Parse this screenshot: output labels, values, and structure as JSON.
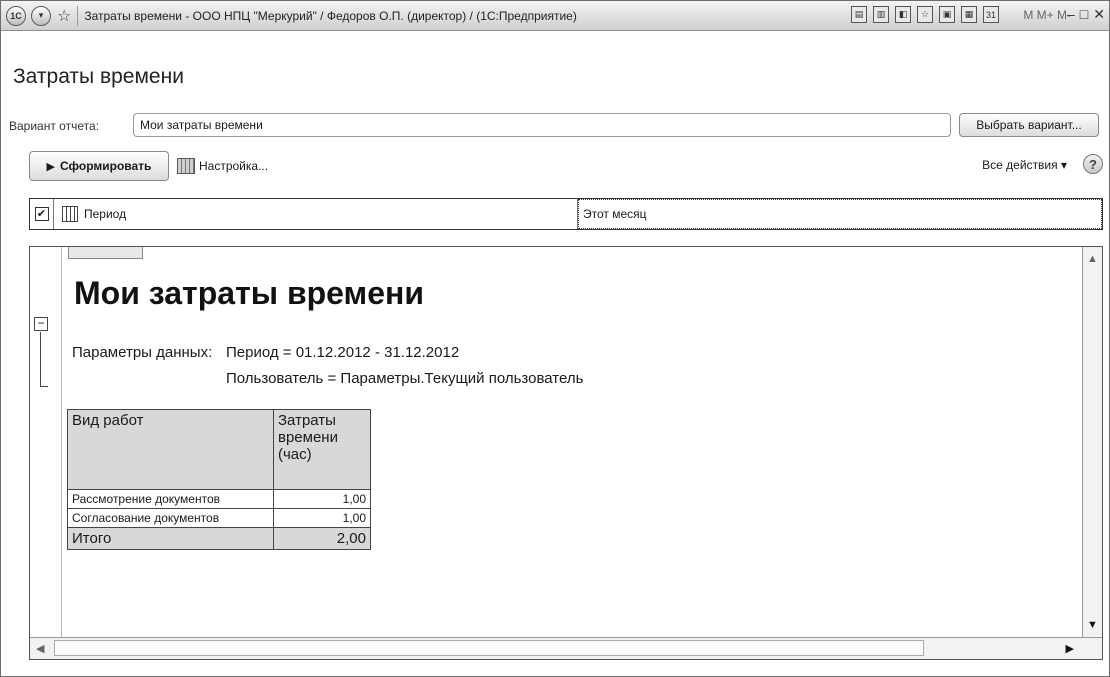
{
  "window": {
    "title": "Затраты времени - ООО НПЦ \"Меркурий\" / Федоров О.П. (директор) / (1С:Предприятие)",
    "logo": "1С",
    "memory_buttons": "M  M+  M-",
    "icons": [
      "save-icon",
      "print-icon",
      "preview-icon",
      "favorite-icon",
      "bookmark-icon",
      "calculator-icon",
      "calendar-icon"
    ]
  },
  "form": {
    "title": "Затраты времени",
    "variant_label": "Вариант отчета:",
    "variant_value": "Мои затраты времени",
    "select_variant_button": "Выбрать вариант...",
    "generate_button": "Сформировать",
    "settings_link": "Настройка...",
    "all_actions": "Все действия ▾",
    "help": "?"
  },
  "parameter": {
    "checked": true,
    "check_mark": "✔",
    "name": "Период",
    "value": "Этот месяц"
  },
  "report": {
    "title": "Мои затраты времени",
    "params_label": "Параметры данных:",
    "params_line1": "Период = 01.12.2012 - 31.12.2012",
    "params_line2": "Пользователь = Параметры.Текущий пользователь",
    "table": {
      "header_work": "Вид работ",
      "header_time": "Затраты времени (час)",
      "rows": [
        {
          "work": "Рассмотрение документов",
          "hours": "1,00"
        },
        {
          "work": "Согласование документов",
          "hours": "1,00"
        }
      ],
      "total_label": "Итого",
      "total_value": "2,00"
    }
  }
}
